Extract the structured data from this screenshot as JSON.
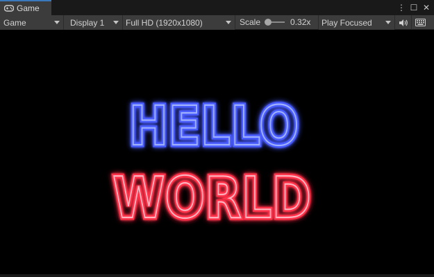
{
  "window": {
    "tab_title": "Game",
    "tab_icon": "gamepad-icon",
    "controls": {
      "more": "⋮",
      "maximize": "☐",
      "close": "✕"
    }
  },
  "toolbar": {
    "view_mode": "Game",
    "display": "Display 1",
    "resolution": "Full HD (1920x1080)",
    "scale_label": "Scale",
    "scale_value": "0.32x",
    "scale_level": 0.0,
    "play_mode": "Play Focused",
    "audio_icon": "speaker-icon",
    "stats_icon": "keyboard-icon"
  },
  "game": {
    "line1": "HELLO",
    "line2": "WORLD",
    "colors": {
      "line1_stroke": "#4a5cff",
      "line1_core": "#9fb0ff",
      "line2_stroke": "#ff3048",
      "line2_core": "#ffb3bf"
    }
  },
  "theme": {
    "accent": "#3a79bb",
    "panel": "#3c3c3c",
    "background": "#000000"
  }
}
